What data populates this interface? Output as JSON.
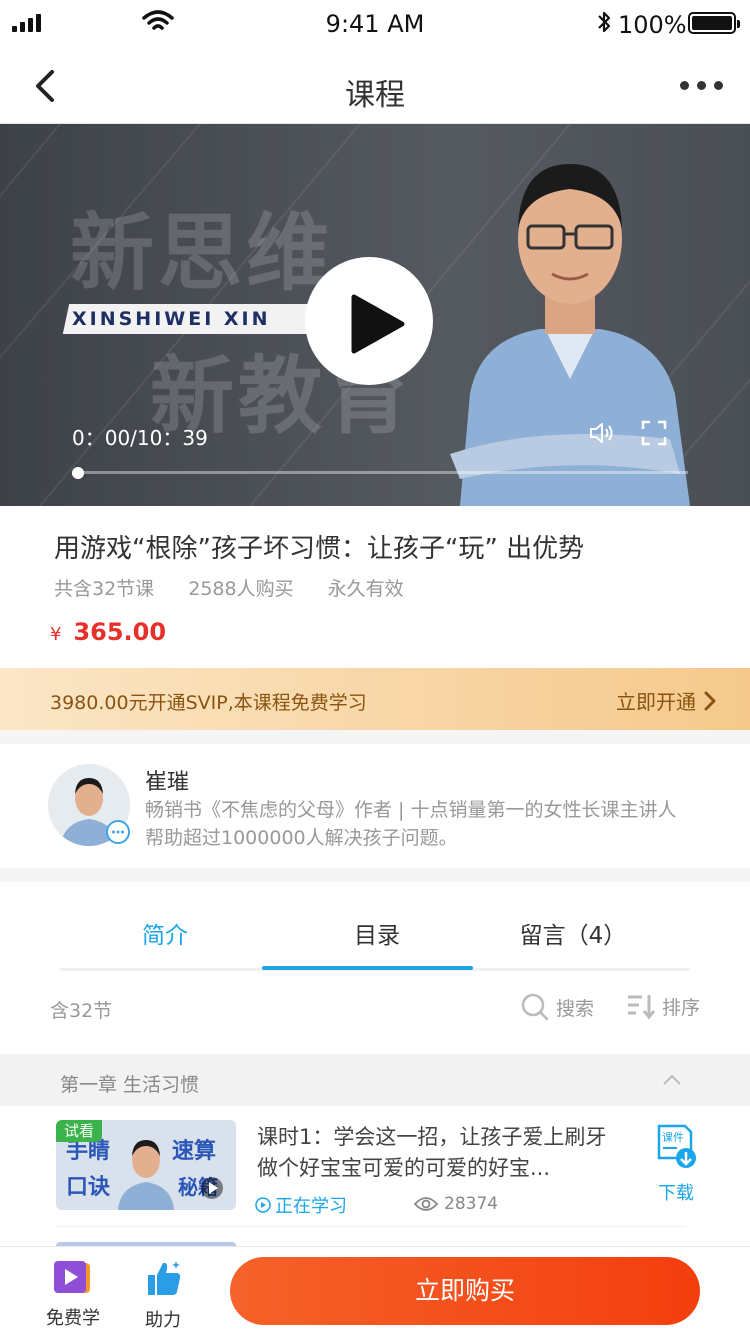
{
  "status_bar": {
    "time": "9:41 AM",
    "battery": "100%"
  },
  "nav": {
    "title": "课程"
  },
  "video": {
    "overlay_text_1": "新思维",
    "overlay_text_2": "新教育",
    "overlay_stripe": "XINSHIWEI  XIN",
    "time": "0：00/10：39",
    "progress": 0.0
  },
  "course": {
    "title": "用游戏“根除”孩子坏习惯：让孩子“玩” 出优势",
    "lessons": "共含32节课",
    "buyers": "2588人购买",
    "validity": "永久有效",
    "currency": "¥",
    "price": "365.00"
  },
  "svip": {
    "text": "3980.00元开通SVIP,本课程免费学习",
    "action": "立即开通"
  },
  "author": {
    "name": "崔璀",
    "desc_line1": "畅销书《不焦虑的父母》作者 | 十点销量第一的女性长课主讲人",
    "desc_line2": "帮助超过1000000人解决孩子问题。"
  },
  "tabs": [
    {
      "label": "简介"
    },
    {
      "label": "目录"
    },
    {
      "label": "留言（4）"
    }
  ],
  "catalog": {
    "count": "含32节",
    "search": "搜索",
    "sort": "排序",
    "chapter": "第一章 生活习惯"
  },
  "lesson": {
    "tag": "试看",
    "thumb_text_1": "手睛",
    "thumb_text_2": "速算",
    "thumb_text_3": "口诀",
    "thumb_text_4": "秘籍",
    "title": "课时1：学会这一招，让孩子爱上刷牙做个好宝宝可爱的可爱的好宝...",
    "status": "正在学习",
    "views": "28374",
    "download_icon_text": "课件",
    "download": "下载"
  },
  "bottom_bar": {
    "free": "免费学",
    "help": "助力",
    "buy": "立即购买"
  },
  "colors": {
    "accent_blue": "#1aa6e8",
    "price_red": "#e8302a",
    "buy_orange": "#f5622a",
    "svip_gold": "#f5c98c"
  }
}
